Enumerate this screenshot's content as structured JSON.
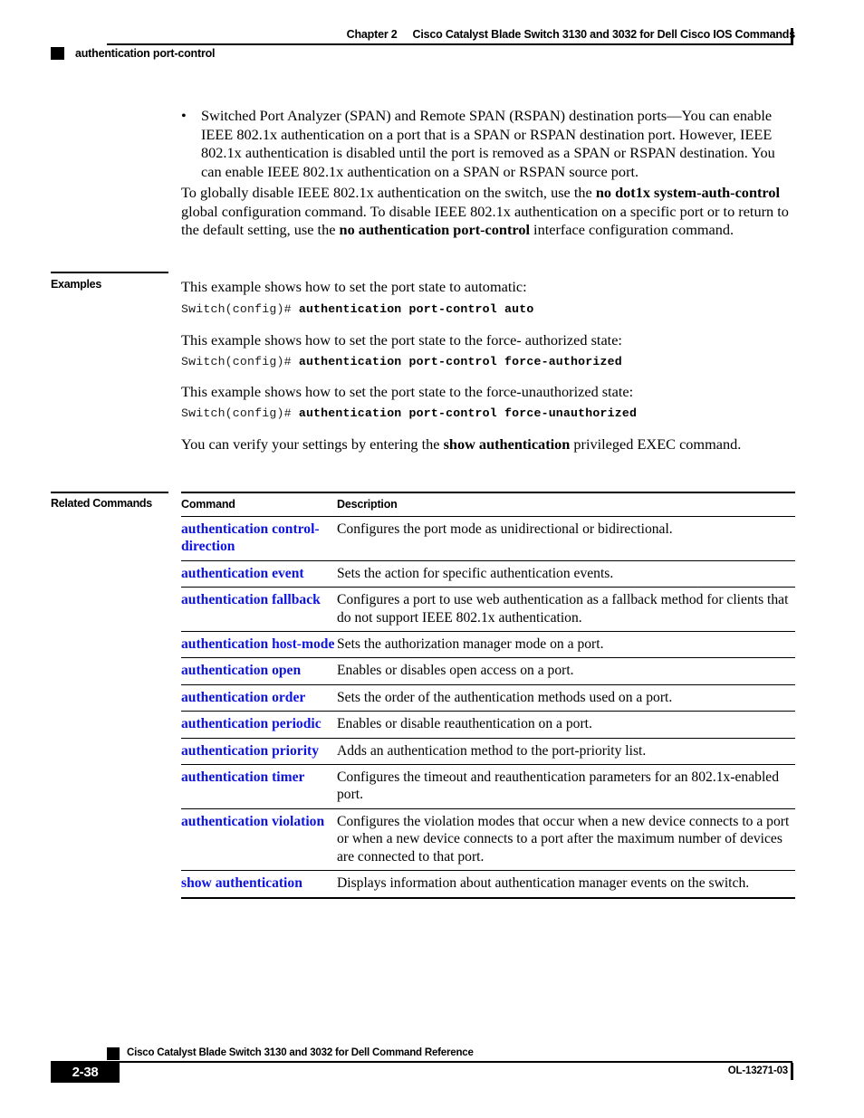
{
  "header": {
    "chapter": "Chapter 2",
    "book_title": "Cisco Catalyst Blade Switch 3130 and 3032 for Dell Cisco IOS Commands",
    "command_name": "authentication port-control"
  },
  "body": {
    "bullet": {
      "marker": "•",
      "text": "Switched Port Analyzer (SPAN) and Remote SPAN (RSPAN) destination ports—You can enable IEEE 802.1x authentication on a port that is a SPAN or RSPAN destination port. However, IEEE 802.1x authentication is disabled until the port is removed as a SPAN or RSPAN destination. You can enable IEEE 802.1x authentication on a SPAN or RSPAN source port."
    },
    "paragraph": {
      "part1": "To globally disable IEEE 802.1x authentication on the switch, use the ",
      "bold1": "no dot1x system-auth-control",
      "part2": " global configuration command. To disable IEEE 802.1x authentication on a specific port or to return to the default setting, use the ",
      "bold2": "no authentication port-control",
      "part3": " interface configuration command."
    }
  },
  "examples": {
    "label": "Examples",
    "intro1": "This example shows how to set the port state to automatic:",
    "code1_prompt": "Switch(config)# ",
    "code1_cmd": "authentication port-control auto",
    "intro2": "This example shows how to set the port state to the force- authorized state:",
    "code2_prompt": "Switch(config)# ",
    "code2_cmd": "authentication port-control force-authorized",
    "intro3": "This example shows how to set the port state to the force-unauthorized state:",
    "code3_prompt": "Switch(config)# ",
    "code3_cmd": "authentication port-control force-unauthorized",
    "verify_part1": "You can verify your settings by entering the ",
    "verify_bold": "show authentication",
    "verify_part2": " privileged EXEC command."
  },
  "related_commands": {
    "label": "Related Commands",
    "columns": {
      "command": "Command",
      "description": "Description"
    },
    "rows": [
      {
        "command": "authentication control-direction",
        "description": "Configures the port mode as unidirectional or bidirectional."
      },
      {
        "command": "authentication event",
        "description": "Sets the action for specific authentication events."
      },
      {
        "command": "authentication fallback",
        "description": "Configures a port to use web authentication as a fallback method for clients that do not support IEEE 802.1x authentication."
      },
      {
        "command": "authentication host-mode",
        "description": "Sets the authorization manager mode on a port."
      },
      {
        "command": "authentication open",
        "description": "Enables or disables open access on a port."
      },
      {
        "command": "authentication order",
        "description": "Sets the order of the authentication methods used on a port."
      },
      {
        "command": "authentication periodic",
        "description": "Enables or disable reauthentication on a port."
      },
      {
        "command": "authentication priority",
        "description": "Adds an authentication method to the port-priority list."
      },
      {
        "command": "authentication timer",
        "description": "Configures the timeout and reauthentication parameters for an 802.1x-enabled port."
      },
      {
        "command": "authentication violation",
        "description": "Configures the violation modes that occur when a new device connects to a port or when a new device connects to a port after the maximum number of devices are connected to that port."
      },
      {
        "command": "show authentication",
        "description": "Displays information about authentication manager events on the switch."
      }
    ]
  },
  "footer": {
    "book_title": "Cisco Catalyst Blade Switch 3130 and 3032 for Dell Command Reference",
    "page_number": "2-38",
    "doc_id": "OL-13271-03"
  },
  "colors": {
    "link_blue": "#0d13e0",
    "rule_black": "#000000"
  }
}
